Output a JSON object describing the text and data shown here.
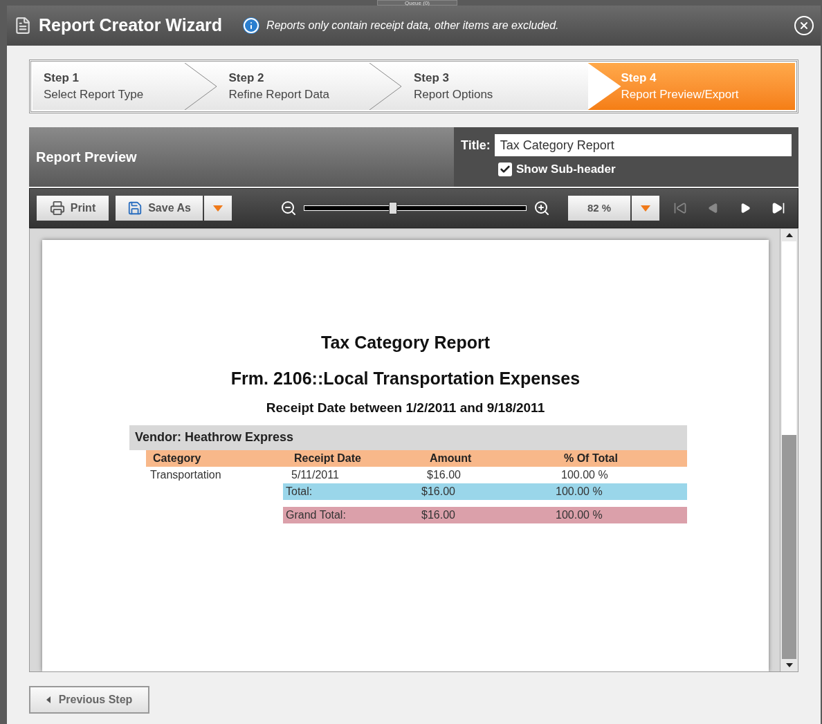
{
  "background": {
    "queue_label": "Queue (0)"
  },
  "window": {
    "title": "Report Creator Wizard",
    "info": "Reports only contain receipt data, other items are excluded."
  },
  "steps": [
    {
      "number": "Step 1",
      "label": "Select Report Type",
      "selected": false
    },
    {
      "number": "Step 2",
      "label": "Refine Report Data",
      "selected": false
    },
    {
      "number": "Step 3",
      "label": "Report Options",
      "selected": false
    },
    {
      "number": "Step 4",
      "label": "Report Preview/Export",
      "selected": true
    }
  ],
  "preview_header": {
    "heading": "Report Preview",
    "title_label": "Title:",
    "title_value": "Tax Category Report",
    "subheader_label": "Show Sub-header",
    "subheader_checked": true
  },
  "toolbar": {
    "print": "Print",
    "save_as": "Save As",
    "level": 0.4,
    "zoom_value": "82 %"
  },
  "report": {
    "title": "Tax Category Report",
    "subtitle": "Frm. 2106::Local Transportation Expenses",
    "date_range": "Receipt Date between 1/2/2011 and 9/18/2011",
    "group": "Vendor: Heathrow Express",
    "columns": [
      "Category",
      "Receipt Date",
      "Amount",
      "% Of Total"
    ],
    "rows": [
      [
        "Transportation",
        "5/11/2011",
        "$16.00",
        "100.00 %"
      ]
    ],
    "total": [
      "Total:",
      "$16.00",
      "100.00 %"
    ],
    "grand_total": [
      "Grand Total:",
      "$16.00",
      "100.00 %"
    ]
  },
  "footer": {
    "previous": "Previous Step"
  }
}
